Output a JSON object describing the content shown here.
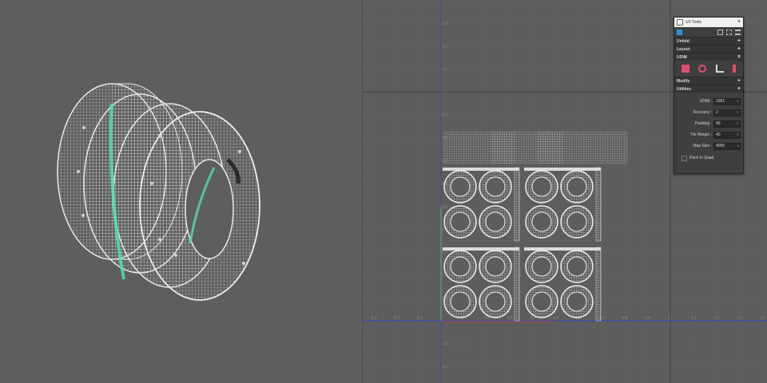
{
  "panel": {
    "title": "UV Tools",
    "sections": {
      "unfold": "Unfold",
      "layout": "Layout",
      "udim": "UDIM",
      "modify": "Modify",
      "utilities": "Utilities"
    },
    "expand_symbol": "+",
    "collapse_symbol": "×",
    "close_symbol": "×",
    "settings": [
      {
        "label": "UDIM :",
        "value": "1001"
      },
      {
        "label": "Accuracy :",
        "value": "2"
      },
      {
        "label": "Padding :",
        "value": "40"
      },
      {
        "label": "Tile Margin :",
        "value": "40"
      },
      {
        "label": "Map Size :",
        "value": "4096"
      }
    ],
    "pack_to_quad_label": "Pack to Quad",
    "colors": {
      "udim_icon": "#e0506e"
    }
  },
  "uv_axis": {
    "x_ticks": [
      "-0.3",
      "-0.2",
      "-0.1",
      "0.1",
      "0.2",
      "0.3",
      "0.4",
      "0.5",
      "0.6",
      "0.7",
      "0.8",
      "0.9",
      "1",
      "1.1",
      "1.2",
      "1.3",
      "1.4"
    ],
    "y_ticks": [
      "0.1",
      "0.2",
      "0.3",
      "0.4",
      "0.5",
      "0.6",
      "0.7",
      "0.8",
      "0.9",
      "1.1",
      "1.2",
      "1.3"
    ],
    "y_neg_ticks": [
      "-0.1",
      "-0.2"
    ],
    "colors": {
      "u_axis": "#3a4fb0",
      "v_axis": "#3a4fb0",
      "green_edge": "#3fbf7f",
      "red_edge": "#c04040"
    }
  },
  "viewport": {
    "colors": {
      "wire": "#e8e8e8",
      "seam": "#55e0a8"
    }
  }
}
